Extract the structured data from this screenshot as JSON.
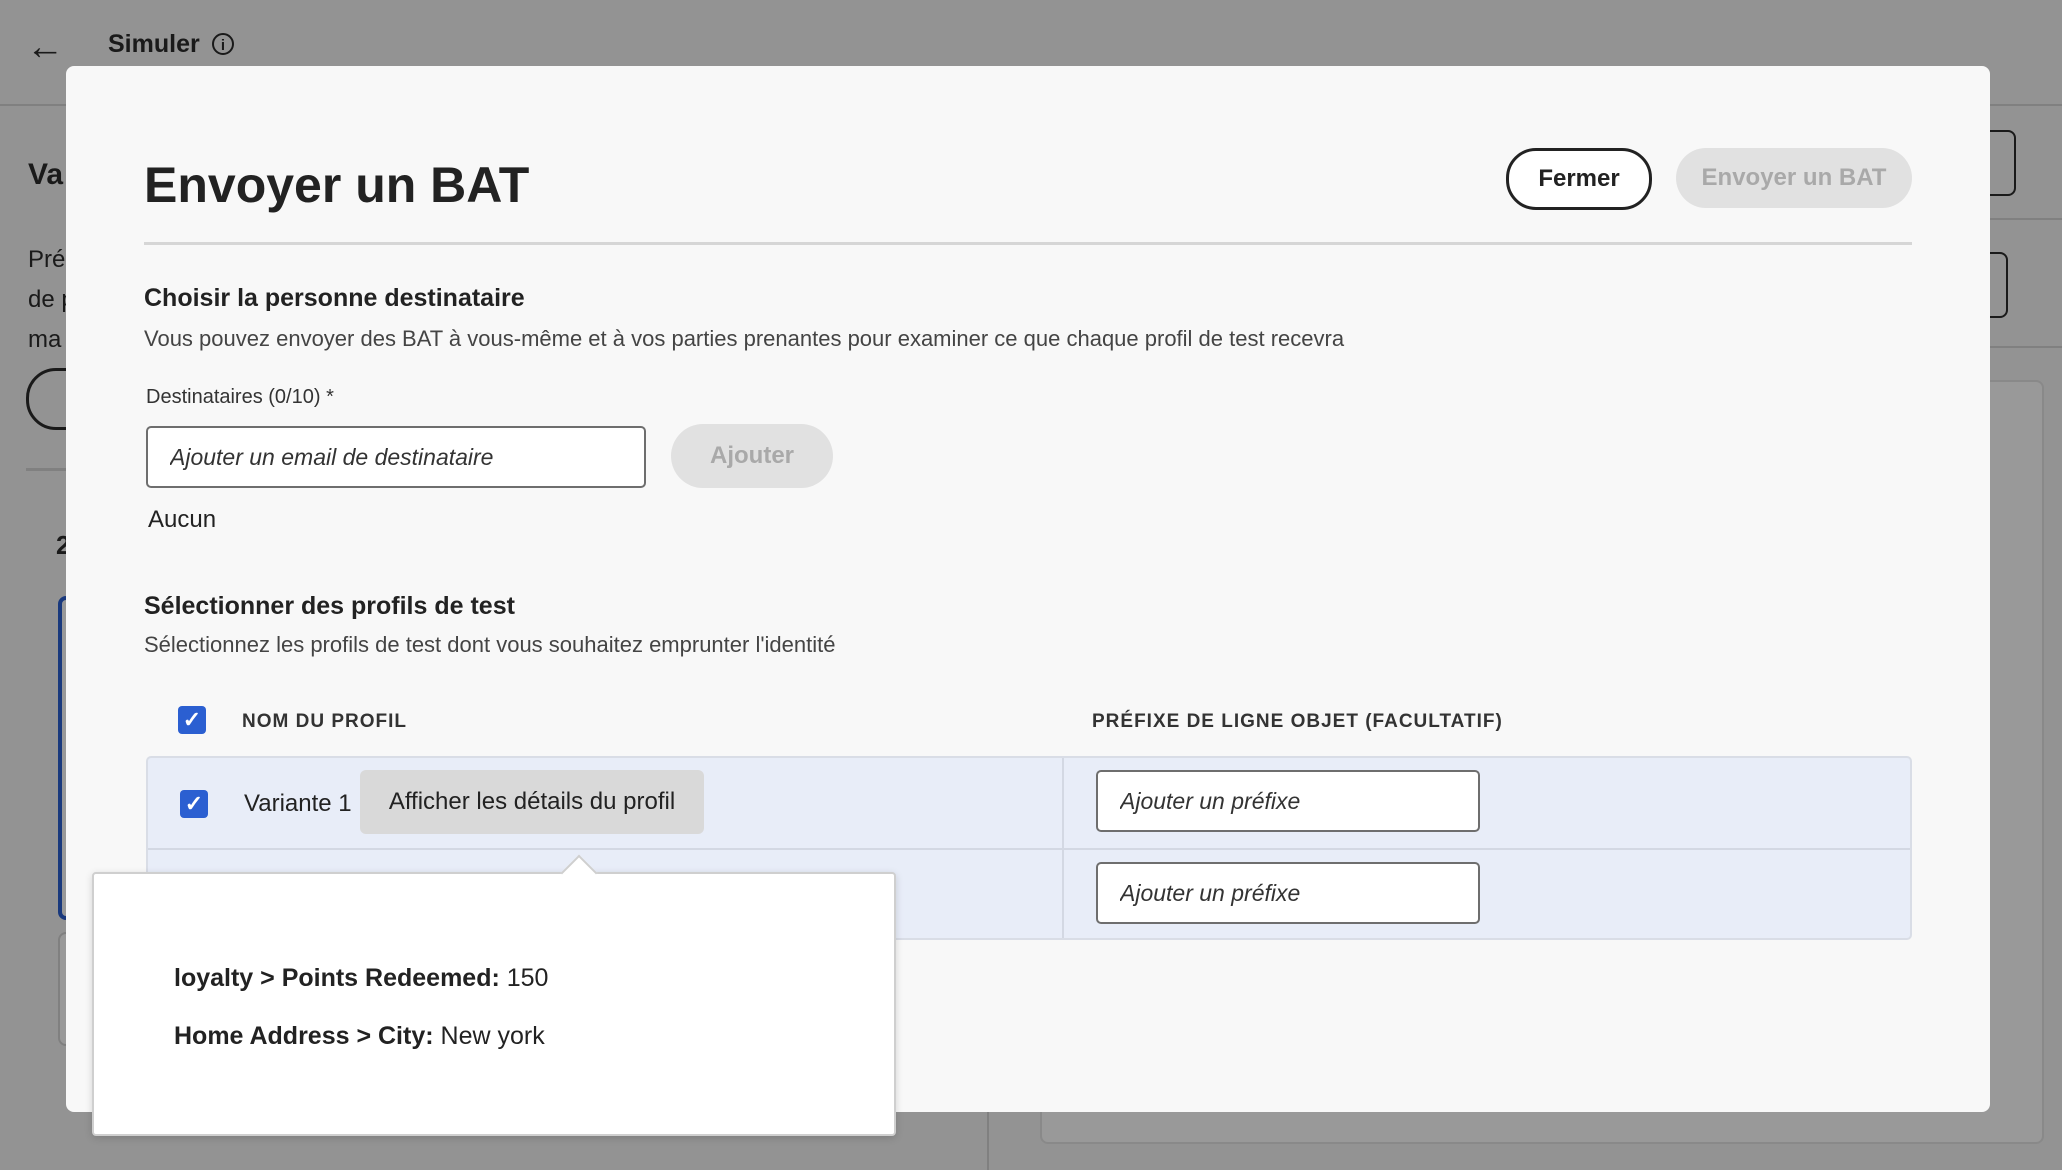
{
  "background": {
    "page_title": "Simuler",
    "left_title": "Va",
    "left_text_lines": [
      "Pré",
      "de p",
      "ma"
    ],
    "left_number": "2"
  },
  "modal": {
    "title": "Envoyer un BAT",
    "close_label": "Fermer",
    "send_label": "Envoyer un BAT",
    "recipient_section": {
      "title": "Choisir la personne destinataire",
      "description": "Vous pouvez envoyer des BAT à vous-même et à vos parties prenantes pour examiner ce que chaque profil de test recevra",
      "field_label": "Destinataires (0/10)",
      "required_mark": "*",
      "email_placeholder": "Ajouter un email de destinataire",
      "add_label": "Ajouter",
      "empty_text": "Aucun"
    },
    "profiles_section": {
      "title": "Sélectionner des profils de test",
      "description": "Sélectionnez les profils de test dont vous souhaitez emprunter l'identité",
      "columns": [
        "NOM DU PROFIL",
        "PRÉFIXE DE LIGNE OBJET (FACULTATIF)"
      ],
      "rows": [
        {
          "name": "Variante 1",
          "details_label": "Afficher les détails du profil",
          "prefix_placeholder": "Ajouter un préfixe",
          "checked": true
        },
        {
          "name": "",
          "prefix_placeholder": "Ajouter un préfixe"
        }
      ]
    }
  },
  "popover": {
    "lines": [
      {
        "key": "loyalty > Points Redeemed:",
        "value": "150"
      },
      {
        "key": "Home Address > City:",
        "value": "New york"
      }
    ]
  },
  "colors": {
    "accent_blue": "#2b5fd1",
    "disabled_bg": "#e1e1e1",
    "disabled_text": "#a9a9a9",
    "table_row_bg": "#e8edf8"
  }
}
